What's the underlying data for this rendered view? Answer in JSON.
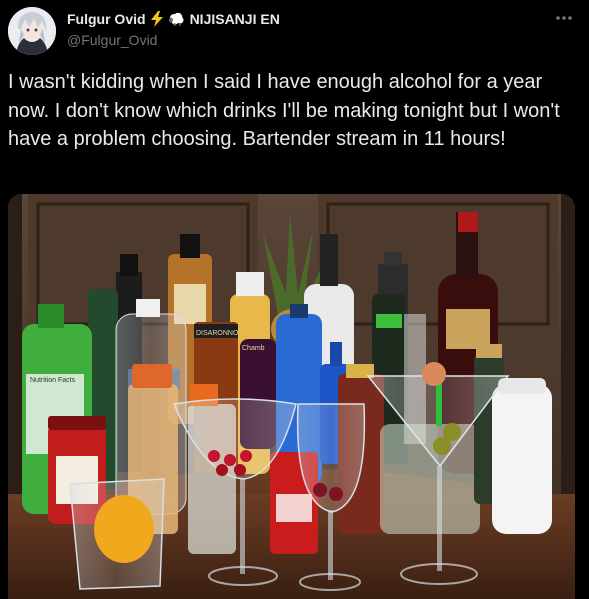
{
  "author": {
    "display_name": "Fulgur Ovid",
    "affiliation": "NIJISANJI EN",
    "handle": "@Fulgur_Ovid",
    "badges": [
      "lightning-bolt-icon",
      "sheep-icon"
    ],
    "avatar_icon": "avatar-icon"
  },
  "tweet": {
    "text": "I wasn't kidding when I said I have enough alcohol for a year now. I don't know which drinks I'll be making tonight but I won't have a problem choosing. Bartender stream in 11 hours!",
    "more_icon": "more-options-icon"
  },
  "media": {
    "label_disaronno": "DISARONNO",
    "label_chambord": "Chamb",
    "label_nutrition": "Nutrition Facts"
  },
  "colors": {
    "background": "#000000",
    "text": "#e7e9ea",
    "muted": "#71767b",
    "lightning": "#f5c518"
  }
}
